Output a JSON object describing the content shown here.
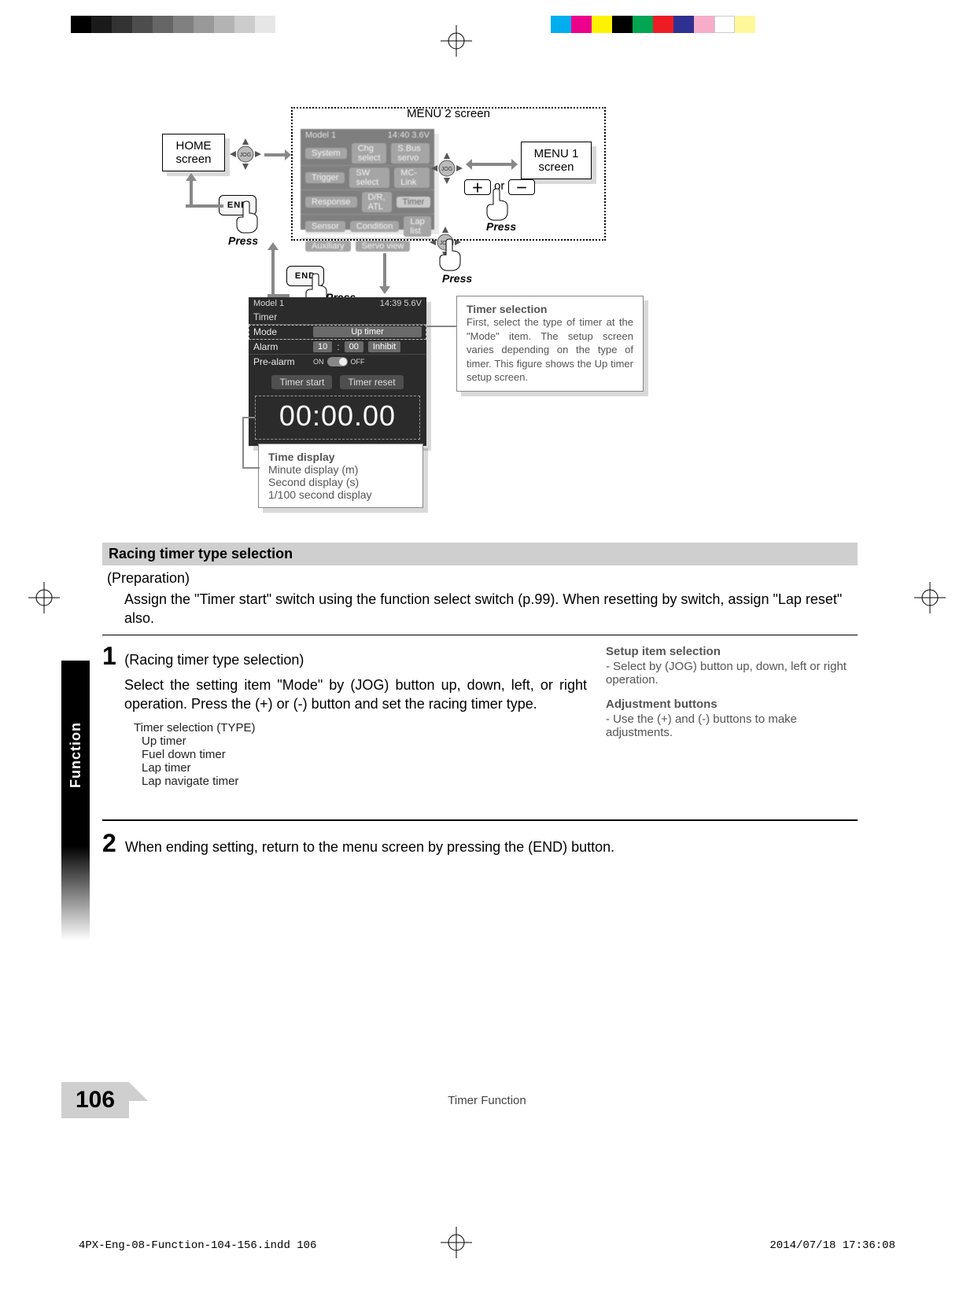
{
  "printmarks": {
    "grayscale": [
      "#000",
      "#1a1a1a",
      "#333",
      "#4d4d4d",
      "#666",
      "#808080",
      "#999",
      "#b3b3b3",
      "#ccc",
      "#e6e6e6"
    ],
    "colors": [
      "#00aeef",
      "#ec008c",
      "#fff200",
      "#000000",
      "#00a651",
      "#ed1c24",
      "#2e3192",
      "#f7adc9",
      "#ffffff",
      "#fff799"
    ]
  },
  "diagram": {
    "home_box_l1": "HOME",
    "home_box_l2": "screen",
    "menu1_box_l1": "MENU 1",
    "menu1_box_l2": "screen",
    "menu2_label": "MENU 2 screen",
    "press": "Press",
    "or": "or",
    "end_label": "END",
    "jog_label": "JOG",
    "menu2_items": {
      "hdr_left": "Model 1",
      "hdr_right": "14:40 3.6V",
      "r1a": "System",
      "r1b": "Chg select",
      "r1c": "S.Bus servo",
      "r2a": "Trigger",
      "r2b": "SW select",
      "r2c": "MC-Link",
      "r3a": "Response",
      "r3b": "D/R, ATL",
      "r3c": "Timer",
      "r4a": "Sensor",
      "r4b": "Condition",
      "r4c": "Lap list",
      "r5a": "Auxiliary",
      "r5b": "Servo view"
    },
    "timer_lcd": {
      "hdr_left": "Model 1",
      "hdr_right": "14:39 5.6V",
      "title": "Timer",
      "mode_lbl": "Mode",
      "mode_val": "Up timer",
      "alarm_lbl": "Alarm",
      "alarm_m": "10",
      "alarm_s": "00",
      "alarm_state": "Inhibit",
      "prealarm_lbl": "Pre-alarm",
      "on": "ON",
      "off": "OFF",
      "start_btn": "Timer start",
      "reset_btn": "Timer reset",
      "big": "00:00.00"
    },
    "callout_timer_title": "Timer selection",
    "callout_timer_body": "First, select the type of timer at the \"Mode\" item. The setup screen varies depending on the type of timer. This figure shows the Up timer setup screen.",
    "callout_time_title": "Time display",
    "callout_time_l1": "Minute display (m)",
    "callout_time_l2": "Second display (s)",
    "callout_time_l3": "1/100 second display"
  },
  "body": {
    "section_title": "Racing timer type selection",
    "prep_label": "(Preparation)",
    "prep_body": "Assign the \"Timer start\" switch using the function select switch (p.99). When resetting by switch, assign \"Lap reset\" also.",
    "step1_num": "1",
    "step1_title": "(Racing timer type selection)",
    "step1_body": "Select the setting item \"Mode\" by (JOG) button up, down, left, or right operation. Press the (+) or (-) button and set the racing timer type.",
    "step1_sub_label": "Timer selection (TYPE)",
    "step1_sub_1": "Up timer",
    "step1_sub_2": "Fuel down timer",
    "step1_sub_3": "Lap timer",
    "step1_sub_4": "Lap navigate timer",
    "side1_h": "Setup item selection",
    "side1_b": "- Select by (JOG) button up, down, left or right operation.",
    "side2_h": "Adjustment buttons",
    "side2_b": "- Use the (+) and (-) buttons to make adjustments.",
    "step2_num": "2",
    "step2_body": "When ending setting, return to the menu screen by pressing the (END) button."
  },
  "chrome": {
    "side_tab": "Function",
    "page_num": "106",
    "footer": "Timer Function",
    "footfile": "4PX-Eng-08-Function-104-156.indd   106",
    "footdate": "2014/07/18   17:36:08"
  }
}
